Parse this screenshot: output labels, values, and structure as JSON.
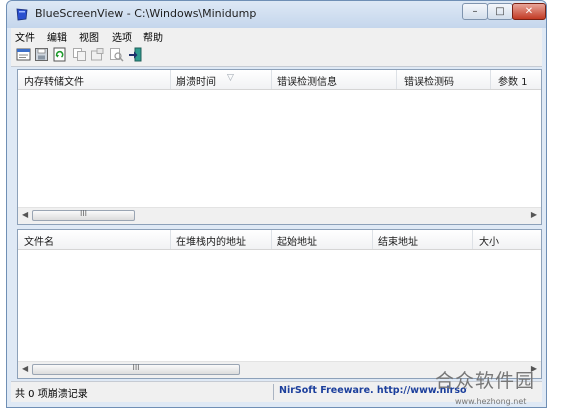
{
  "window": {
    "title": "BlueScreenView  -  C:\\Windows\\Minidump"
  },
  "window_buttons": {
    "minimize": "–",
    "maximize": "□",
    "close": "✕"
  },
  "menu": {
    "items": [
      "文件",
      "编辑",
      "视图",
      "选项",
      "帮助"
    ]
  },
  "toolbar": {
    "icons": [
      "html-report-icon",
      "save-icon",
      "refresh-icon",
      "copy-icon",
      "properties-icon",
      "find-icon",
      "exit-icon"
    ]
  },
  "top_pane": {
    "columns": [
      "内存转储文件",
      "崩溃时间",
      "错误检测信息",
      "错误检测码",
      "参数 1"
    ],
    "sort_indicator": "▽",
    "scroll_grip": "III"
  },
  "bottom_pane": {
    "columns": [
      "文件名",
      "在堆栈内的地址",
      "起始地址",
      "结束地址",
      "大小"
    ],
    "scroll_grip": "III"
  },
  "status": {
    "left": "共 0 项崩溃记录",
    "right": "NirSoft Freeware.  http://www.nirsoft.net"
  },
  "watermark": {
    "text": "合众软件园",
    "url": "www.hezhong.net"
  },
  "colors": {
    "titlebar": "#c5d6ec",
    "close_button": "#c23a24",
    "link": "#1c3f9c"
  }
}
